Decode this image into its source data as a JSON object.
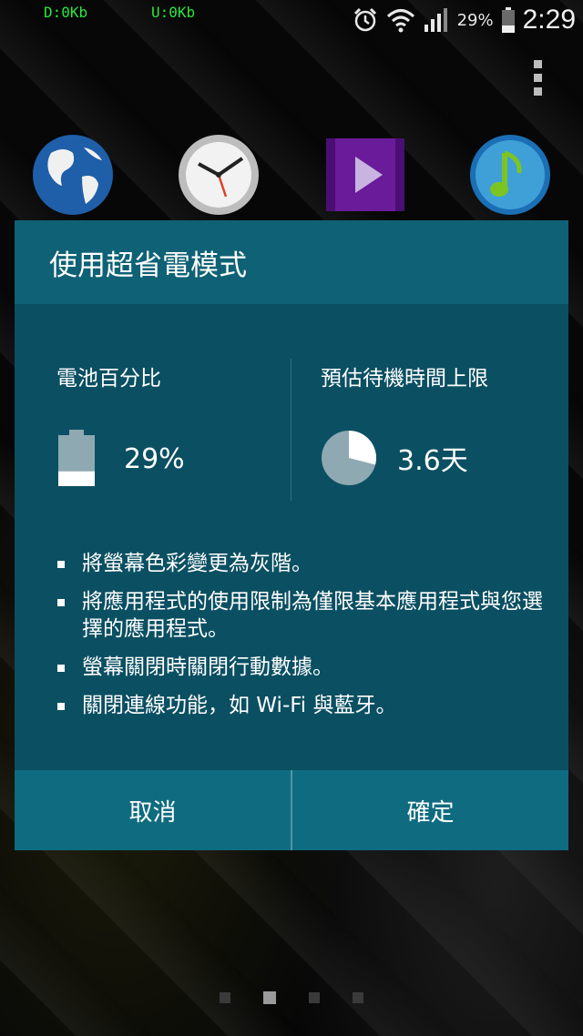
{
  "status_bar": {
    "download": "D:0Kb",
    "upload": "U:0Kb",
    "battery_percent": "29%",
    "time": "2:29",
    "icons": [
      "alarm-icon",
      "wifi-icon",
      "signal-icon",
      "battery-icon"
    ]
  },
  "home": {
    "icons": [
      "globe-icon",
      "clock-icon",
      "video-icon",
      "music-icon"
    ],
    "page_count": 4,
    "active_page": 2
  },
  "dialog": {
    "title": "使用超省電模式",
    "battery": {
      "label": "電池百分比",
      "value": "29%",
      "level": 0.29
    },
    "standby": {
      "label": "預估待機時間上限",
      "value": "3.6天",
      "pie_fraction": 0.29
    },
    "bullets": [
      "將螢幕色彩變更為灰階。",
      "將應用程式的使用限制為僅限基本應用程式與您選擇的應用程式。",
      "螢幕關閉時關閉行動數據。",
      "關閉連線功能，如 Wi-Fi 與藍牙。"
    ],
    "cancel_label": "取消",
    "confirm_label": "確定"
  },
  "colors": {
    "dialog_bg": "#0b4f62",
    "title_bg": "#0f6276",
    "button_bar_bg": "#0f6b80",
    "status_net_text": "#29e83a"
  }
}
